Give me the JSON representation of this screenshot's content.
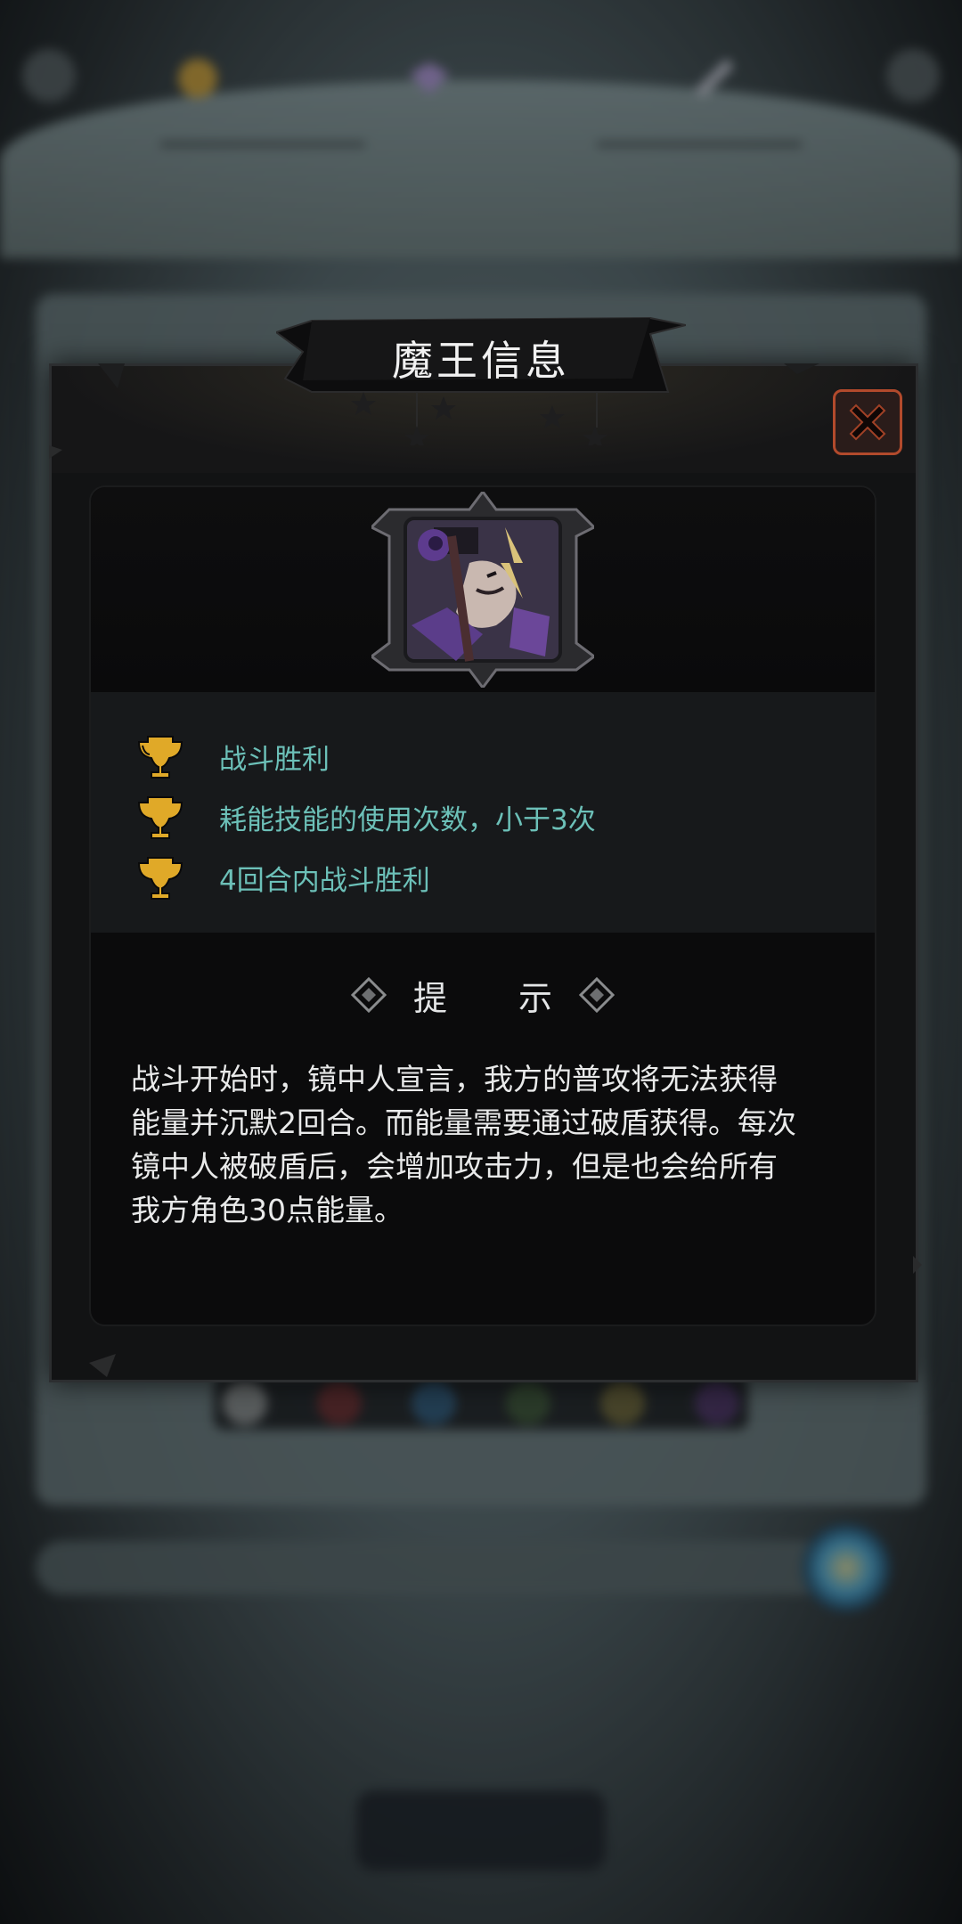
{
  "status_bar": {
    "time": "",
    "battery": ""
  },
  "resources": {
    "coins": "",
    "gems": "",
    "feathers": ""
  },
  "background": {
    "title": "",
    "bar_label": "",
    "confirm_label": ""
  },
  "modal": {
    "title": "魔王信息",
    "goals": [
      {
        "text": "战斗胜利"
      },
      {
        "text": "耗能技能的使用次数，小于3次"
      },
      {
        "text": "4回合内战斗胜利"
      }
    ],
    "tip_title": "提 示",
    "tip_lines": [
      "战斗开始时，镜中人宣言，我方的普攻将无法获得",
      "能量并沉默2回合。而能量需要通过破盾获得。每次",
      "镜中人被破盾后，会增加攻击力，但是也会给所有",
      "我方角色30点能量。"
    ]
  },
  "icons": {
    "close": "close-x-icon",
    "trophy": "trophy-icon",
    "tip_decor": "diamond-icon",
    "boss": "boss-portrait"
  },
  "colors": {
    "goal_text": "#6cc0b8",
    "close_border": "#b24a2c",
    "trophy_gold": "#e0a928"
  }
}
